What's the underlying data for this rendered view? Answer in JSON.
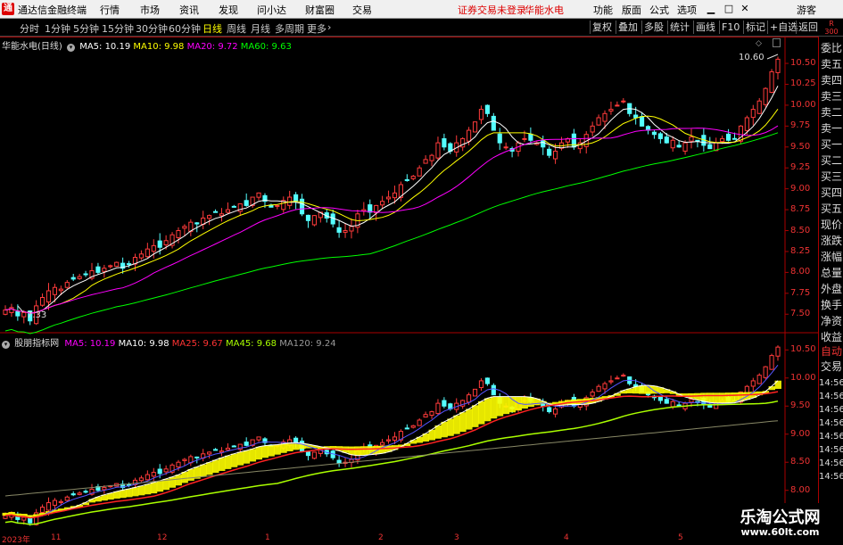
{
  "app": {
    "title": "通达信金融终端",
    "menu": [
      "行情",
      "市场",
      "资讯",
      "发现",
      "问小达",
      "财富圈",
      "交易"
    ],
    "notice": "证券交易未登录",
    "stock_name": "华能水电",
    "right_menu": [
      "功能",
      "版面",
      "公式",
      "选项"
    ],
    "guest": "游客"
  },
  "toolbar": {
    "periods": [
      "分时",
      "1分钟",
      "5分钟",
      "15分钟",
      "30分钟",
      "60分钟",
      "日线",
      "周线",
      "月线",
      "多周期",
      "更多"
    ],
    "active_period": "日线",
    "right_items": [
      "复权",
      "叠加",
      "多股",
      "统计",
      "画线",
      "F10",
      "标记",
      "+自选",
      "返回"
    ]
  },
  "main_panel": {
    "title": "华能水电(日线)",
    "ma": [
      {
        "label": "MA5: 10.19",
        "color": "#ffffff"
      },
      {
        "label": "MA10: 9.98",
        "color": "#ffff00"
      },
      {
        "label": "MA20: 9.72",
        "color": "#ff00ff"
      },
      {
        "label": "MA60: 9.63",
        "color": "#00ff00"
      }
    ],
    "high_label": "10.60",
    "low_label": "7.33",
    "yticks": [
      "10.50",
      "10.25",
      "10.00",
      "9.75",
      "9.50",
      "9.25",
      "9.00",
      "8.75",
      "8.50",
      "8.25",
      "8.00",
      "7.75",
      "7.50"
    ]
  },
  "sub_panel": {
    "title": "股朋指标网",
    "ma": [
      {
        "label": "MA5: 10.19",
        "color": "#ff00ff"
      },
      {
        "label": "MA10: 9.98",
        "color": "#ffffff"
      },
      {
        "label": "MA25: 9.67",
        "color": "#ff3333"
      },
      {
        "label": "MA45: 9.68",
        "color": "#aaff00"
      },
      {
        "label": "MA120: 9.24",
        "color": "#999999"
      }
    ],
    "yticks": [
      "10.50",
      "10.00",
      "9.50",
      "9.00",
      "8.50",
      "8.00"
    ]
  },
  "right_sidebar": {
    "top": "R",
    "top_num": "300",
    "items": [
      "委比",
      "卖五",
      "卖四",
      "卖三",
      "卖二",
      "卖一",
      "买一",
      "买二",
      "买三",
      "买四",
      "买五",
      "现价",
      "涨跌",
      "涨幅",
      "总量",
      "外盘",
      "换手",
      "净资",
      "收益"
    ],
    "auto": "自动",
    "trade": "交易",
    "times": [
      "14:56",
      "14:56",
      "14:56",
      "14:56",
      "14:56",
      "14:56",
      "14:56",
      "14:56"
    ]
  },
  "xaxis": {
    "labels": [
      "2023年",
      "11",
      "12",
      "1",
      "2",
      "3",
      "4",
      "5"
    ]
  },
  "watermark": {
    "line1": "乐淘公式网",
    "line2": "www.60lt.com"
  },
  "chart_data": {
    "type": "candlestick",
    "series_closes": [
      7.55,
      7.58,
      7.48,
      7.52,
      7.42,
      7.6,
      7.7,
      7.78,
      7.82,
      7.8,
      7.88,
      7.92,
      7.95,
      7.98,
      8.02,
      8.0,
      8.05,
      8.08,
      8.12,
      8.05,
      8.1,
      8.18,
      8.22,
      8.28,
      8.32,
      8.3,
      8.38,
      8.45,
      8.5,
      8.55,
      8.6,
      8.58,
      8.65,
      8.68,
      8.72,
      8.7,
      8.75,
      8.78,
      8.82,
      8.8,
      8.9,
      8.95,
      8.85,
      8.78,
      8.8,
      8.86,
      8.9,
      8.85,
      8.7,
      8.62,
      8.68,
      8.72,
      8.65,
      8.58,
      8.48,
      8.5,
      8.55,
      8.7,
      8.75,
      8.72,
      8.8,
      8.85,
      8.9,
      8.95,
      9.05,
      9.1,
      9.15,
      9.25,
      9.35,
      9.4,
      9.55,
      9.5,
      9.45,
      9.55,
      9.6,
      9.7,
      9.8,
      9.95,
      9.9,
      9.7,
      9.55,
      9.5,
      9.45,
      9.55,
      9.6,
      9.58,
      9.55,
      9.5,
      9.4,
      9.45,
      9.55,
      9.6,
      9.5,
      9.55,
      9.65,
      9.75,
      9.85,
      9.9,
      9.95,
      10.0,
      10.05,
      9.9,
      9.85,
      9.75,
      9.7,
      9.65,
      9.6,
      9.55,
      9.58,
      9.5,
      9.55,
      9.62,
      9.58,
      9.52,
      9.48,
      9.55,
      9.6,
      9.58,
      9.6,
      9.75,
      9.85,
      9.95,
      10.05,
      10.2,
      10.4,
      10.55
    ],
    "ylim_main": [
      7.3,
      10.65
    ],
    "ylim_sub": [
      7.9,
      10.6
    ]
  }
}
